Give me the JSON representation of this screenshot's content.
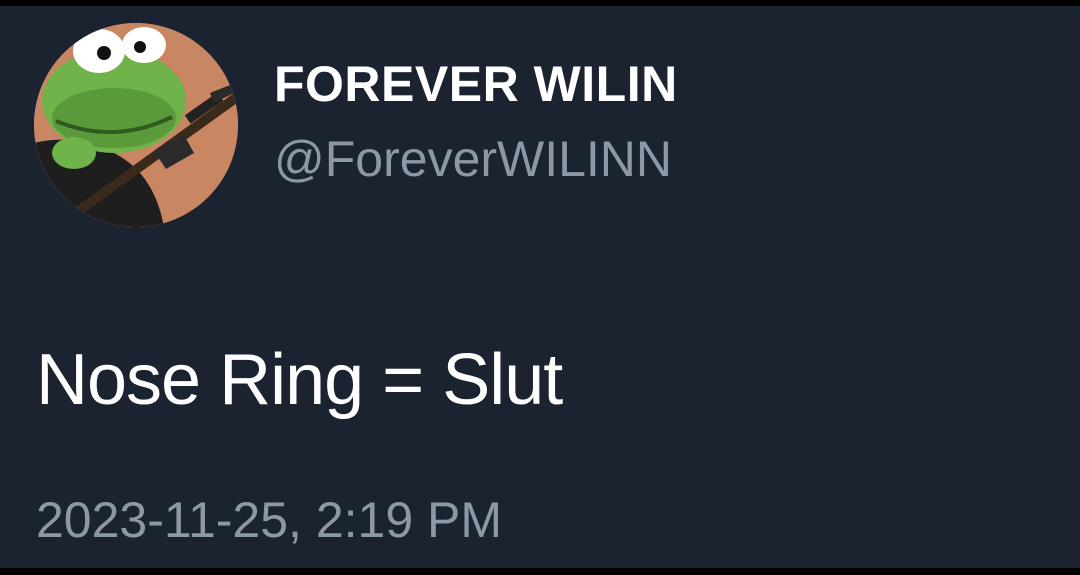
{
  "tweet": {
    "avatar_icon": "frog-avatar-icon",
    "display_name": "FOREVER WILIN",
    "handle": "@ForeverWILINN",
    "text": "Nose Ring = Slut",
    "timestamp": "2023-11-25, 2:19 PM"
  },
  "colors": {
    "background": "#1b2330",
    "name": "#ffffff",
    "handle": "#8b98a5",
    "avatar_bg": "#c98662",
    "frog_green": "#6fb34a"
  }
}
